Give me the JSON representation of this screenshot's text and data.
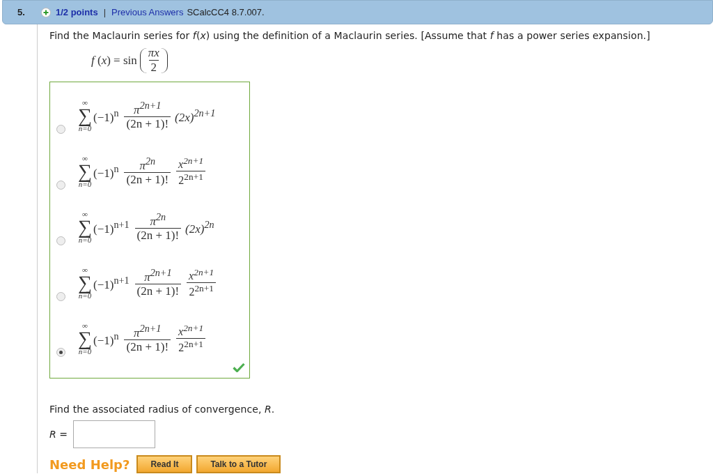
{
  "header": {
    "number": "5.",
    "points": "1/2 points",
    "separator": "|",
    "previous_answers": "Previous Answers",
    "code": "SCalcCC4 8.7.007."
  },
  "prompt": "Find the Maclaurin series for *f*(*x*) using the definition of a Maclaurin series. [Assume that *f* has a power series expansion.]",
  "function": {
    "lhs": "*f* (*x*) = sin",
    "numerator": "*πx*",
    "denominator": "2"
  },
  "choices": [
    {
      "selected": false,
      "upper": "∞",
      "sigma": "∑",
      "lower": "n=0",
      "sign": "(−1)$^{n}$",
      "numerator": "π$^{2n+1}$",
      "denominator": "(2n + 1)!",
      "kind": "power",
      "factor": "(2x)$^{2n+1}$"
    },
    {
      "selected": false,
      "upper": "∞",
      "sigma": "∑",
      "lower": "n=0",
      "sign": "(−1)$^{n}$",
      "numerator": "π$^{2n}$",
      "denominator": "(2n + 1)!",
      "kind": "fraction",
      "factor_numerator": "x$^{2n+1}$",
      "factor_denominator": "2$^{2n+1}$"
    },
    {
      "selected": false,
      "upper": "∞",
      "sigma": "∑",
      "lower": "n=0",
      "sign": "(−1)$^{n+1}$",
      "numerator": "π$^{2n}$",
      "denominator": "(2n + 1)!",
      "kind": "power",
      "factor": "(2x)$^{2n}$"
    },
    {
      "selected": false,
      "upper": "∞",
      "sigma": "∑",
      "lower": "n=0",
      "sign": "(−1)$^{n+1}$",
      "numerator": "π$^{2n+1}$",
      "denominator": "(2n + 1)!",
      "kind": "fraction",
      "factor_numerator": "x$^{2n+1}$",
      "factor_denominator": "2$^{2n+1}$"
    },
    {
      "selected": true,
      "upper": "∞",
      "sigma": "∑",
      "lower": "n=0",
      "sign": "(−1)$^{n}$",
      "numerator": "π$^{2n+1}$",
      "denominator": "(2n + 1)!",
      "kind": "fraction",
      "factor_numerator": "x$^{2n+1}$",
      "factor_denominator": "2$^{2n+1}$"
    }
  ],
  "answer_correct": true,
  "radius_prompt": "Find the associated radius of convergence, *R*.",
  "radius_field": {
    "label": "*R* ="
  },
  "help": {
    "label": "Need Help?",
    "buttons": [
      "Read It",
      "Talk to a Tutor"
    ]
  }
}
